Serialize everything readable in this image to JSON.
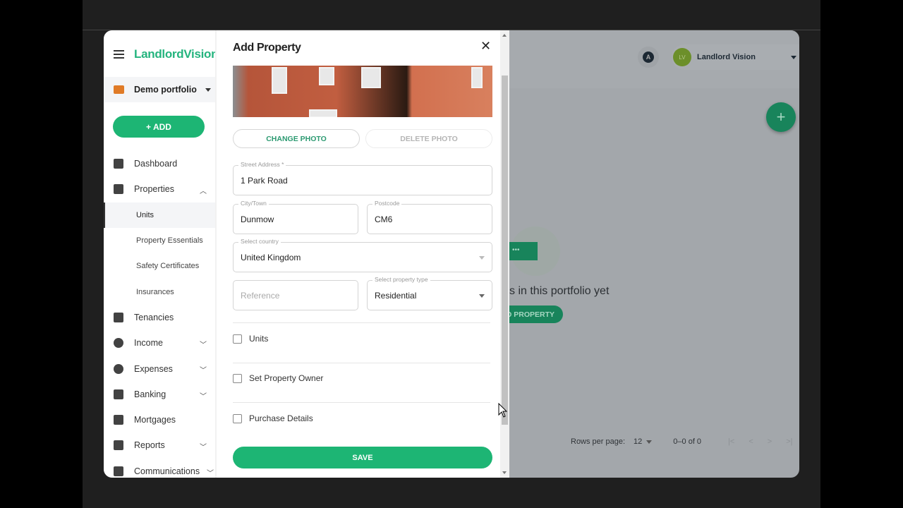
{
  "sidebar": {
    "logo": "LandlordVision",
    "portfolio": "Demo portfolio",
    "add_label": "+ ADD",
    "items": [
      {
        "label": "Dashboard",
        "icon": "dashboard-icon"
      },
      {
        "label": "Properties",
        "icon": "home-icon",
        "expanded": true
      },
      {
        "label": "Units",
        "sub": true,
        "active": true
      },
      {
        "label": "Property Essentials",
        "sub": true
      },
      {
        "label": "Safety Certificates",
        "sub": true
      },
      {
        "label": "Insurances",
        "sub": true
      },
      {
        "label": "Tenancies",
        "icon": "contact-icon"
      },
      {
        "label": "Income",
        "icon": "plus-circle-icon"
      },
      {
        "label": "Expenses",
        "icon": "minus-circle-icon"
      },
      {
        "label": "Banking",
        "icon": "bank-icon"
      },
      {
        "label": "Mortgages",
        "icon": "pound-house-icon"
      },
      {
        "label": "Reports",
        "icon": "bar-chart-icon"
      },
      {
        "label": "Communications",
        "icon": "chat-icon"
      }
    ]
  },
  "header": {
    "user_initials": "LV",
    "user_name": "Landlord Vision",
    "accessibility_badge": "A"
  },
  "empty_state": {
    "text": "s in this portfolio yet",
    "button": "D PROPERTY"
  },
  "pagination": {
    "rows_label": "Rows per page:",
    "rows_value": "12",
    "range": "0–0 of 0"
  },
  "dialog": {
    "title": "Add Property",
    "change_photo": "CHANGE PHOTO",
    "delete_photo": "DELETE PHOTO",
    "street": {
      "label": "Street Address *",
      "value": "1 Park Road"
    },
    "city": {
      "label": "City/Town",
      "value": "Dunmow"
    },
    "postcode": {
      "label": "Postcode",
      "value": "CM6"
    },
    "country": {
      "label": "Select country",
      "value": "United Kingdom"
    },
    "reference": {
      "placeholder": "Reference"
    },
    "property_type": {
      "label": "Select property type",
      "value": "Residential"
    },
    "checkboxes": [
      "Units",
      "Set Property Owner",
      "Purchase Details"
    ],
    "save": "SAVE"
  },
  "colors": {
    "brand": "#1db574",
    "portfolio_icon": "#e07b27",
    "avatar": "#6c8f2a"
  }
}
